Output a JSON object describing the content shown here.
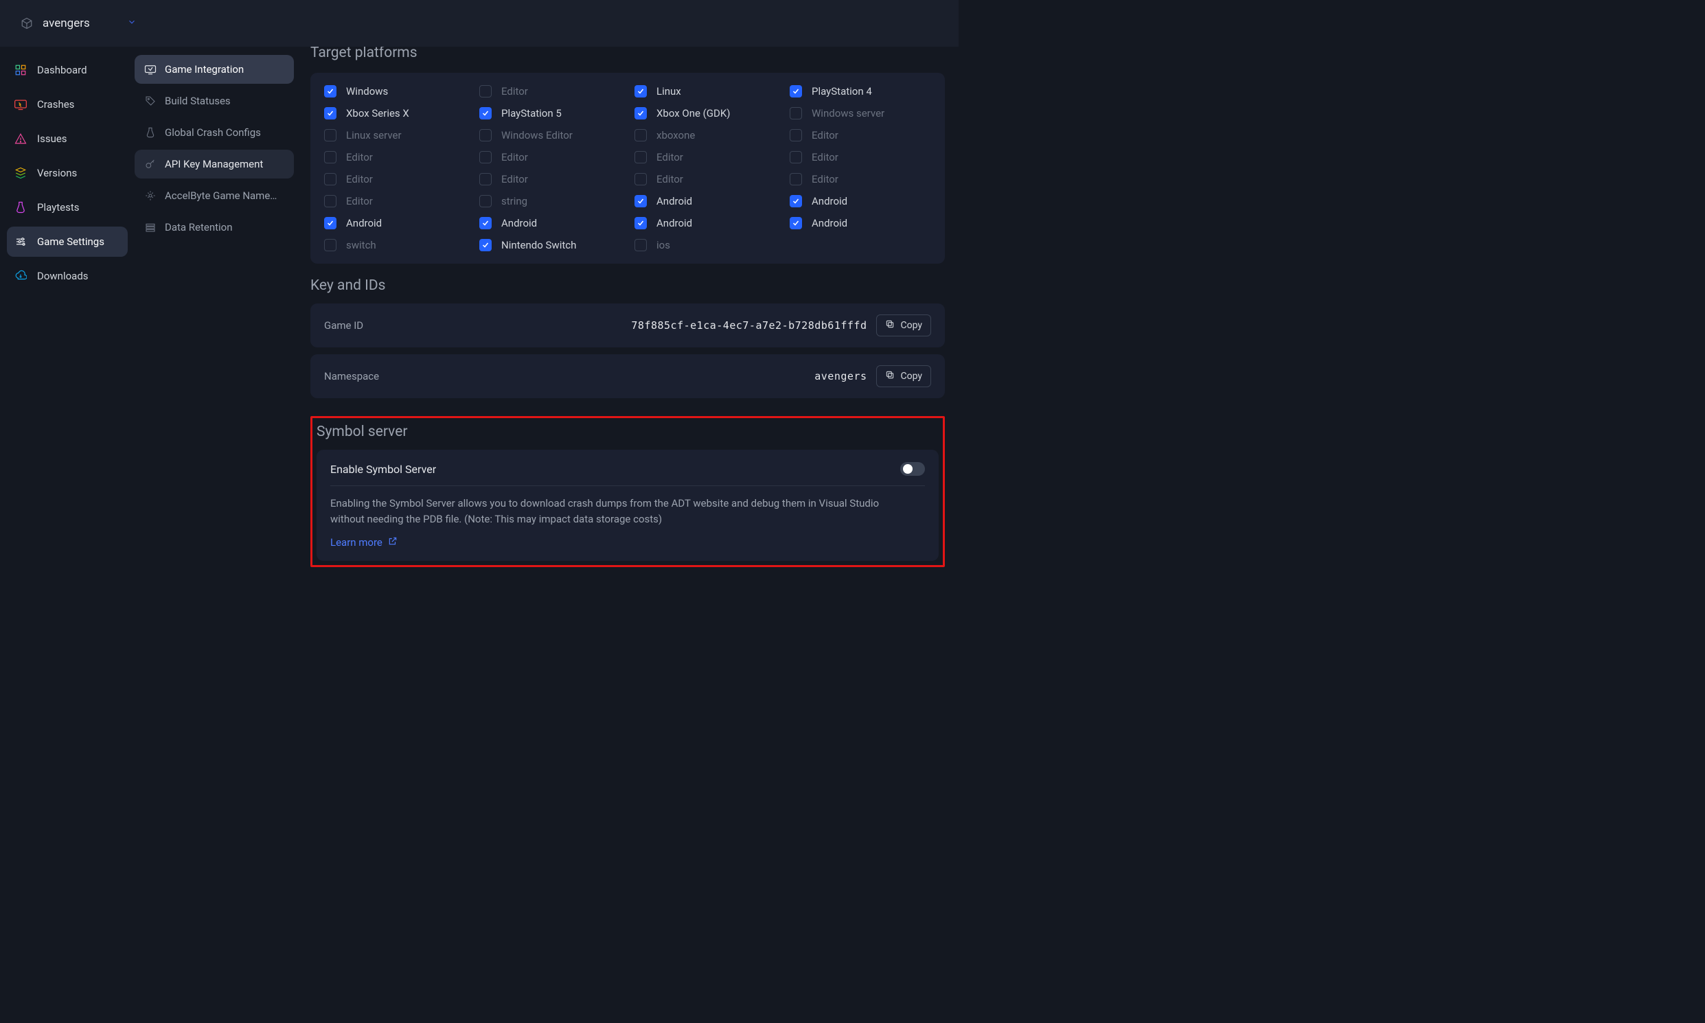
{
  "topbar": {
    "project": "avengers"
  },
  "sidebar1": {
    "items": [
      {
        "label": "Dashboard"
      },
      {
        "label": "Crashes"
      },
      {
        "label": "Issues"
      },
      {
        "label": "Versions"
      },
      {
        "label": "Playtests"
      },
      {
        "label": "Game Settings"
      },
      {
        "label": "Downloads"
      }
    ]
  },
  "sidebar2": {
    "items": [
      {
        "label": "Game Integration"
      },
      {
        "label": "Build Statuses"
      },
      {
        "label": "Global Crash Configs"
      },
      {
        "label": "API Key Management"
      },
      {
        "label": "AccelByte Game Name…"
      },
      {
        "label": "Data Retention"
      }
    ]
  },
  "sections": {
    "platforms_title": "Target platforms",
    "keys_title": "Key and IDs",
    "symbol_title": "Symbol server"
  },
  "platforms": [
    {
      "label": "Windows",
      "checked": true
    },
    {
      "label": "Editor",
      "checked": false
    },
    {
      "label": "Linux",
      "checked": true
    },
    {
      "label": "PlayStation 4",
      "checked": true
    },
    {
      "label": "Xbox Series X",
      "checked": true
    },
    {
      "label": "PlayStation 5",
      "checked": true
    },
    {
      "label": "Xbox One (GDK)",
      "checked": true
    },
    {
      "label": "Windows server",
      "checked": false
    },
    {
      "label": "Linux server",
      "checked": false
    },
    {
      "label": "Windows Editor",
      "checked": false
    },
    {
      "label": "xboxone",
      "checked": false
    },
    {
      "label": "Editor",
      "checked": false
    },
    {
      "label": "Editor",
      "checked": false
    },
    {
      "label": "Editor",
      "checked": false
    },
    {
      "label": "Editor",
      "checked": false
    },
    {
      "label": "Editor",
      "checked": false
    },
    {
      "label": "Editor",
      "checked": false
    },
    {
      "label": "Editor",
      "checked": false
    },
    {
      "label": "Editor",
      "checked": false
    },
    {
      "label": "Editor",
      "checked": false
    },
    {
      "label": "Editor",
      "checked": false
    },
    {
      "label": "string",
      "checked": false
    },
    {
      "label": "Android",
      "checked": true
    },
    {
      "label": "Android",
      "checked": true
    },
    {
      "label": "Android",
      "checked": true
    },
    {
      "label": "Android",
      "checked": true
    },
    {
      "label": "Android",
      "checked": true
    },
    {
      "label": "Android",
      "checked": true
    },
    {
      "label": "switch",
      "checked": false
    },
    {
      "label": "Nintendo Switch",
      "checked": true
    },
    {
      "label": "ios",
      "checked": false
    }
  ],
  "keys": {
    "game_id_label": "Game ID",
    "game_id_value": "78f885cf-e1ca-4ec7-a7e2-b728db61fffd",
    "namespace_label": "Namespace",
    "namespace_value": "avengers",
    "copy_label": "Copy"
  },
  "symbol": {
    "enable_label": "Enable Symbol Server",
    "description": "Enabling the Symbol Server allows you to download crash dumps from the ADT website and debug them in Visual Studio without needing the PDB file. (Note: This may impact data storage costs)",
    "learn_more": "Learn more"
  }
}
